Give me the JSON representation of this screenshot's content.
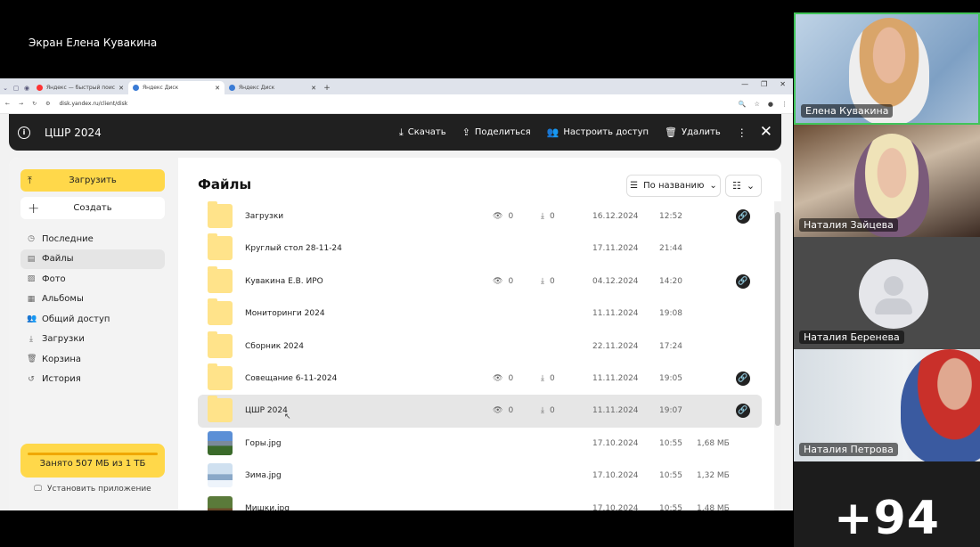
{
  "screen_label": "Экран Елена Кувакина",
  "browser": {
    "tabs": [
      {
        "label": "Яндекс — быстрый поиск в и...",
        "active": false
      },
      {
        "label": "Яндекс Диск",
        "active": true
      },
      {
        "label": "Яндекс Диск",
        "active": false
      }
    ],
    "url": "disk.yandex.ru/client/disk"
  },
  "disk": {
    "folder_title": "ЦШР 2024",
    "actions": {
      "download": "Скачать",
      "share": "Поделиться",
      "access": "Настроить доступ",
      "delete": "Удалить"
    },
    "upload_label": "Загрузить",
    "create_label": "Создать",
    "nav": [
      "Последние",
      "Файлы",
      "Фото",
      "Альбомы",
      "Общий доступ",
      "Загрузки",
      "Корзина",
      "История"
    ],
    "quota_text": "Занято 507 МБ из 1 ТБ",
    "quota_used_fraction": 0.0005,
    "install_app": "Установить приложение",
    "section_title": "Файлы",
    "sort_label": "По названию",
    "files": [
      {
        "name": "Загрузки",
        "type": "folder",
        "views": "0",
        "downloads": "0",
        "date": "16.12.2024",
        "time": "12:52",
        "size": "",
        "link": true
      },
      {
        "name": "Круглый стол 28-11-24",
        "type": "folder",
        "views": "",
        "downloads": "",
        "date": "17.11.2024",
        "time": "21:44",
        "size": "",
        "link": false
      },
      {
        "name": "Кувакина Е.В. ИРО",
        "type": "folder",
        "views": "0",
        "downloads": "0",
        "date": "04.12.2024",
        "time": "14:20",
        "size": "",
        "link": true
      },
      {
        "name": "Мониторинги 2024",
        "type": "folder",
        "views": "",
        "downloads": "",
        "date": "11.11.2024",
        "time": "19:08",
        "size": "",
        "link": false
      },
      {
        "name": "Сборник 2024",
        "type": "folder",
        "views": "",
        "downloads": "",
        "date": "22.11.2024",
        "time": "17:24",
        "size": "",
        "link": false
      },
      {
        "name": "Совещание 6-11-2024",
        "type": "folder",
        "views": "0",
        "downloads": "0",
        "date": "11.11.2024",
        "time": "19:05",
        "size": "",
        "link": true
      },
      {
        "name": "ЦШР 2024",
        "type": "folder",
        "views": "0",
        "downloads": "0",
        "date": "11.11.2024",
        "time": "19:07",
        "size": "",
        "link": true,
        "highlighted": true
      },
      {
        "name": "Горы.jpg",
        "type": "image-mountains",
        "views": "",
        "downloads": "",
        "date": "17.10.2024",
        "time": "10:55",
        "size": "1,68 МБ",
        "link": false
      },
      {
        "name": "Зима.jpg",
        "type": "image-winter",
        "views": "",
        "downloads": "",
        "date": "17.10.2024",
        "time": "10:55",
        "size": "1,32 МБ",
        "link": false
      },
      {
        "name": "Мишки.jpg",
        "type": "image-bears",
        "views": "",
        "downloads": "",
        "date": "17.10.2024",
        "time": "10:55",
        "size": "1,48 МБ",
        "link": false
      }
    ]
  },
  "participants": [
    {
      "name": "Елена Кувакина",
      "speaking": true
    },
    {
      "name": "Наталия Зайцева"
    },
    {
      "name": "Наталия Беренева"
    },
    {
      "name": "Наталия Петрова"
    }
  ],
  "more_participants": "+94",
  "colors": {
    "accent_yellow": "#ffd84a",
    "topbar": "#202020",
    "speaking_border": "#41c45a"
  }
}
